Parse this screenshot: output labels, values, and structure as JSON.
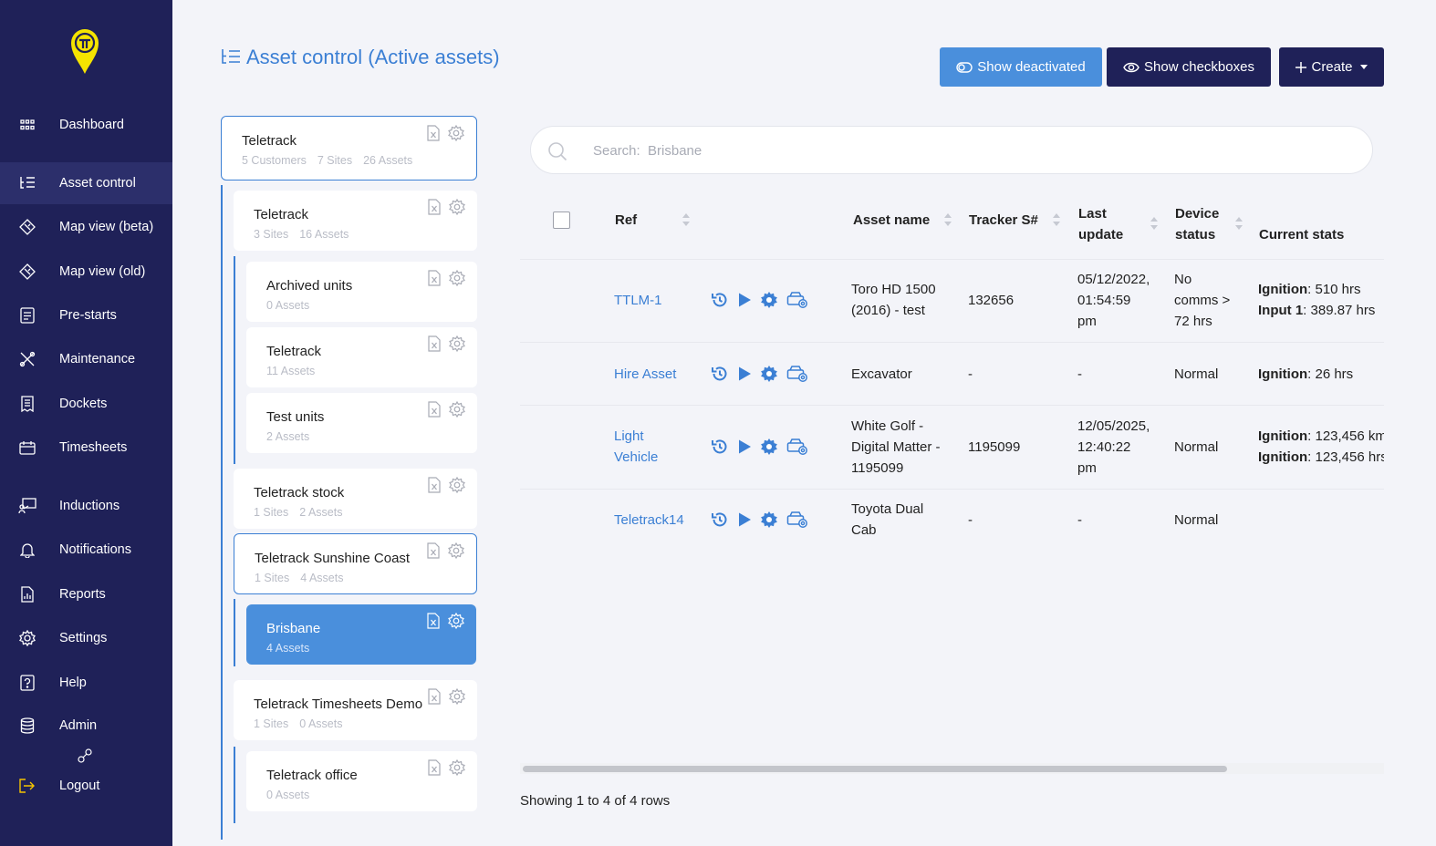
{
  "sidebar": {
    "items": [
      {
        "label": "Dashboard",
        "icon": "grid-icon"
      },
      {
        "label": "Asset control",
        "icon": "list-tree-icon"
      },
      {
        "label": "Map view (beta)",
        "icon": "map-icon"
      },
      {
        "label": "Map view (old)",
        "icon": "map-icon"
      },
      {
        "label": "Pre-starts",
        "icon": "checklist-icon"
      },
      {
        "label": "Maintenance",
        "icon": "tools-icon"
      },
      {
        "label": "Dockets",
        "icon": "docket-icon"
      },
      {
        "label": "Timesheets",
        "icon": "calendar-icon"
      },
      {
        "label": "Inductions",
        "icon": "presentation-icon"
      },
      {
        "label": "Notifications",
        "icon": "bell-icon"
      },
      {
        "label": "Reports",
        "icon": "report-icon"
      },
      {
        "label": "Settings",
        "icon": "gear-icon"
      },
      {
        "label": "Help",
        "icon": "help-icon"
      },
      {
        "label": "Admin",
        "icon": "database-icon"
      },
      {
        "label": "Logout",
        "icon": "logout-icon"
      }
    ]
  },
  "header": {
    "title": "Asset control (Active assets)",
    "show_deactivated": "Show deactivated",
    "show_checkboxes": "Show checkboxes",
    "create": "Create"
  },
  "tree": [
    {
      "title": "Teletrack",
      "meta": [
        "5 Customers",
        "7 Sites",
        "26 Assets"
      ]
    },
    {
      "title": "Teletrack",
      "meta": [
        "3 Sites",
        "16 Assets"
      ]
    },
    {
      "title": "Archived units",
      "meta": [
        "0 Assets"
      ]
    },
    {
      "title": "Teletrack",
      "meta": [
        "11 Assets"
      ]
    },
    {
      "title": "Test units",
      "meta": [
        "2 Assets"
      ]
    },
    {
      "title": "Teletrack stock",
      "meta": [
        "1 Sites",
        "2 Assets"
      ]
    },
    {
      "title": "Teletrack Sunshine Coast",
      "meta": [
        "1 Sites",
        "4 Assets"
      ]
    },
    {
      "title": "Brisbane",
      "meta": [
        "4 Assets"
      ]
    },
    {
      "title": "Teletrack Timesheets Demo",
      "meta": [
        "1 Sites",
        "0 Assets"
      ]
    },
    {
      "title": "Teletrack office",
      "meta": [
        "0 Assets"
      ]
    }
  ],
  "search": {
    "placeholder": "Search:  Brisbane"
  },
  "table": {
    "headers": {
      "ref": "Ref",
      "asset_name": "Asset name",
      "tracker": "Tracker S#",
      "last_update_1": "Last",
      "last_update_2": "update",
      "device_status_1": "Device",
      "device_status_2": "status",
      "current_stats": "Current stats"
    },
    "rows": [
      {
        "ref": "TTLM-1",
        "name_lines": [
          "Toro HD 1500",
          "(2016) - test"
        ],
        "tracker": "132656",
        "update_lines": [
          "05/12/2022,",
          "01:54:59",
          "pm"
        ],
        "status_lines": [
          "No",
          "comms >",
          "72 hrs"
        ],
        "stats": [
          {
            "k": "Ignition",
            "v": ": 510 hrs"
          },
          {
            "k": "Input 1",
            "v": ": 389.87 hrs"
          }
        ]
      },
      {
        "ref": "Hire Asset",
        "name_lines": [
          "Excavator"
        ],
        "tracker": "-",
        "update_lines": [
          "-"
        ],
        "status_lines": [
          "Normal"
        ],
        "stats": [
          {
            "k": "Ignition",
            "v": ": 26 hrs"
          }
        ]
      },
      {
        "ref_lines": [
          "Light",
          "Vehicle"
        ],
        "ref": "Light Vehicle",
        "name_lines": [
          "White Golf -",
          "Digital Matter -",
          "1195099"
        ],
        "tracker": "1195099",
        "update_lines": [
          "12/05/2025,",
          "12:40:22",
          "pm"
        ],
        "status_lines": [
          "Normal"
        ],
        "stats": [
          {
            "k": "Ignition",
            "v": ": 123,456 km"
          },
          {
            "k": "Ignition",
            "v": ": 123,456 hrs"
          }
        ]
      },
      {
        "ref": "Teletrack14",
        "name_lines": [
          "Toyota Dual",
          "Cab"
        ],
        "tracker": "-",
        "update_lines": [
          "-"
        ],
        "status_lines": [
          "Normal"
        ],
        "stats": []
      }
    ]
  },
  "footer": "Showing 1 to 4 of 4 rows"
}
